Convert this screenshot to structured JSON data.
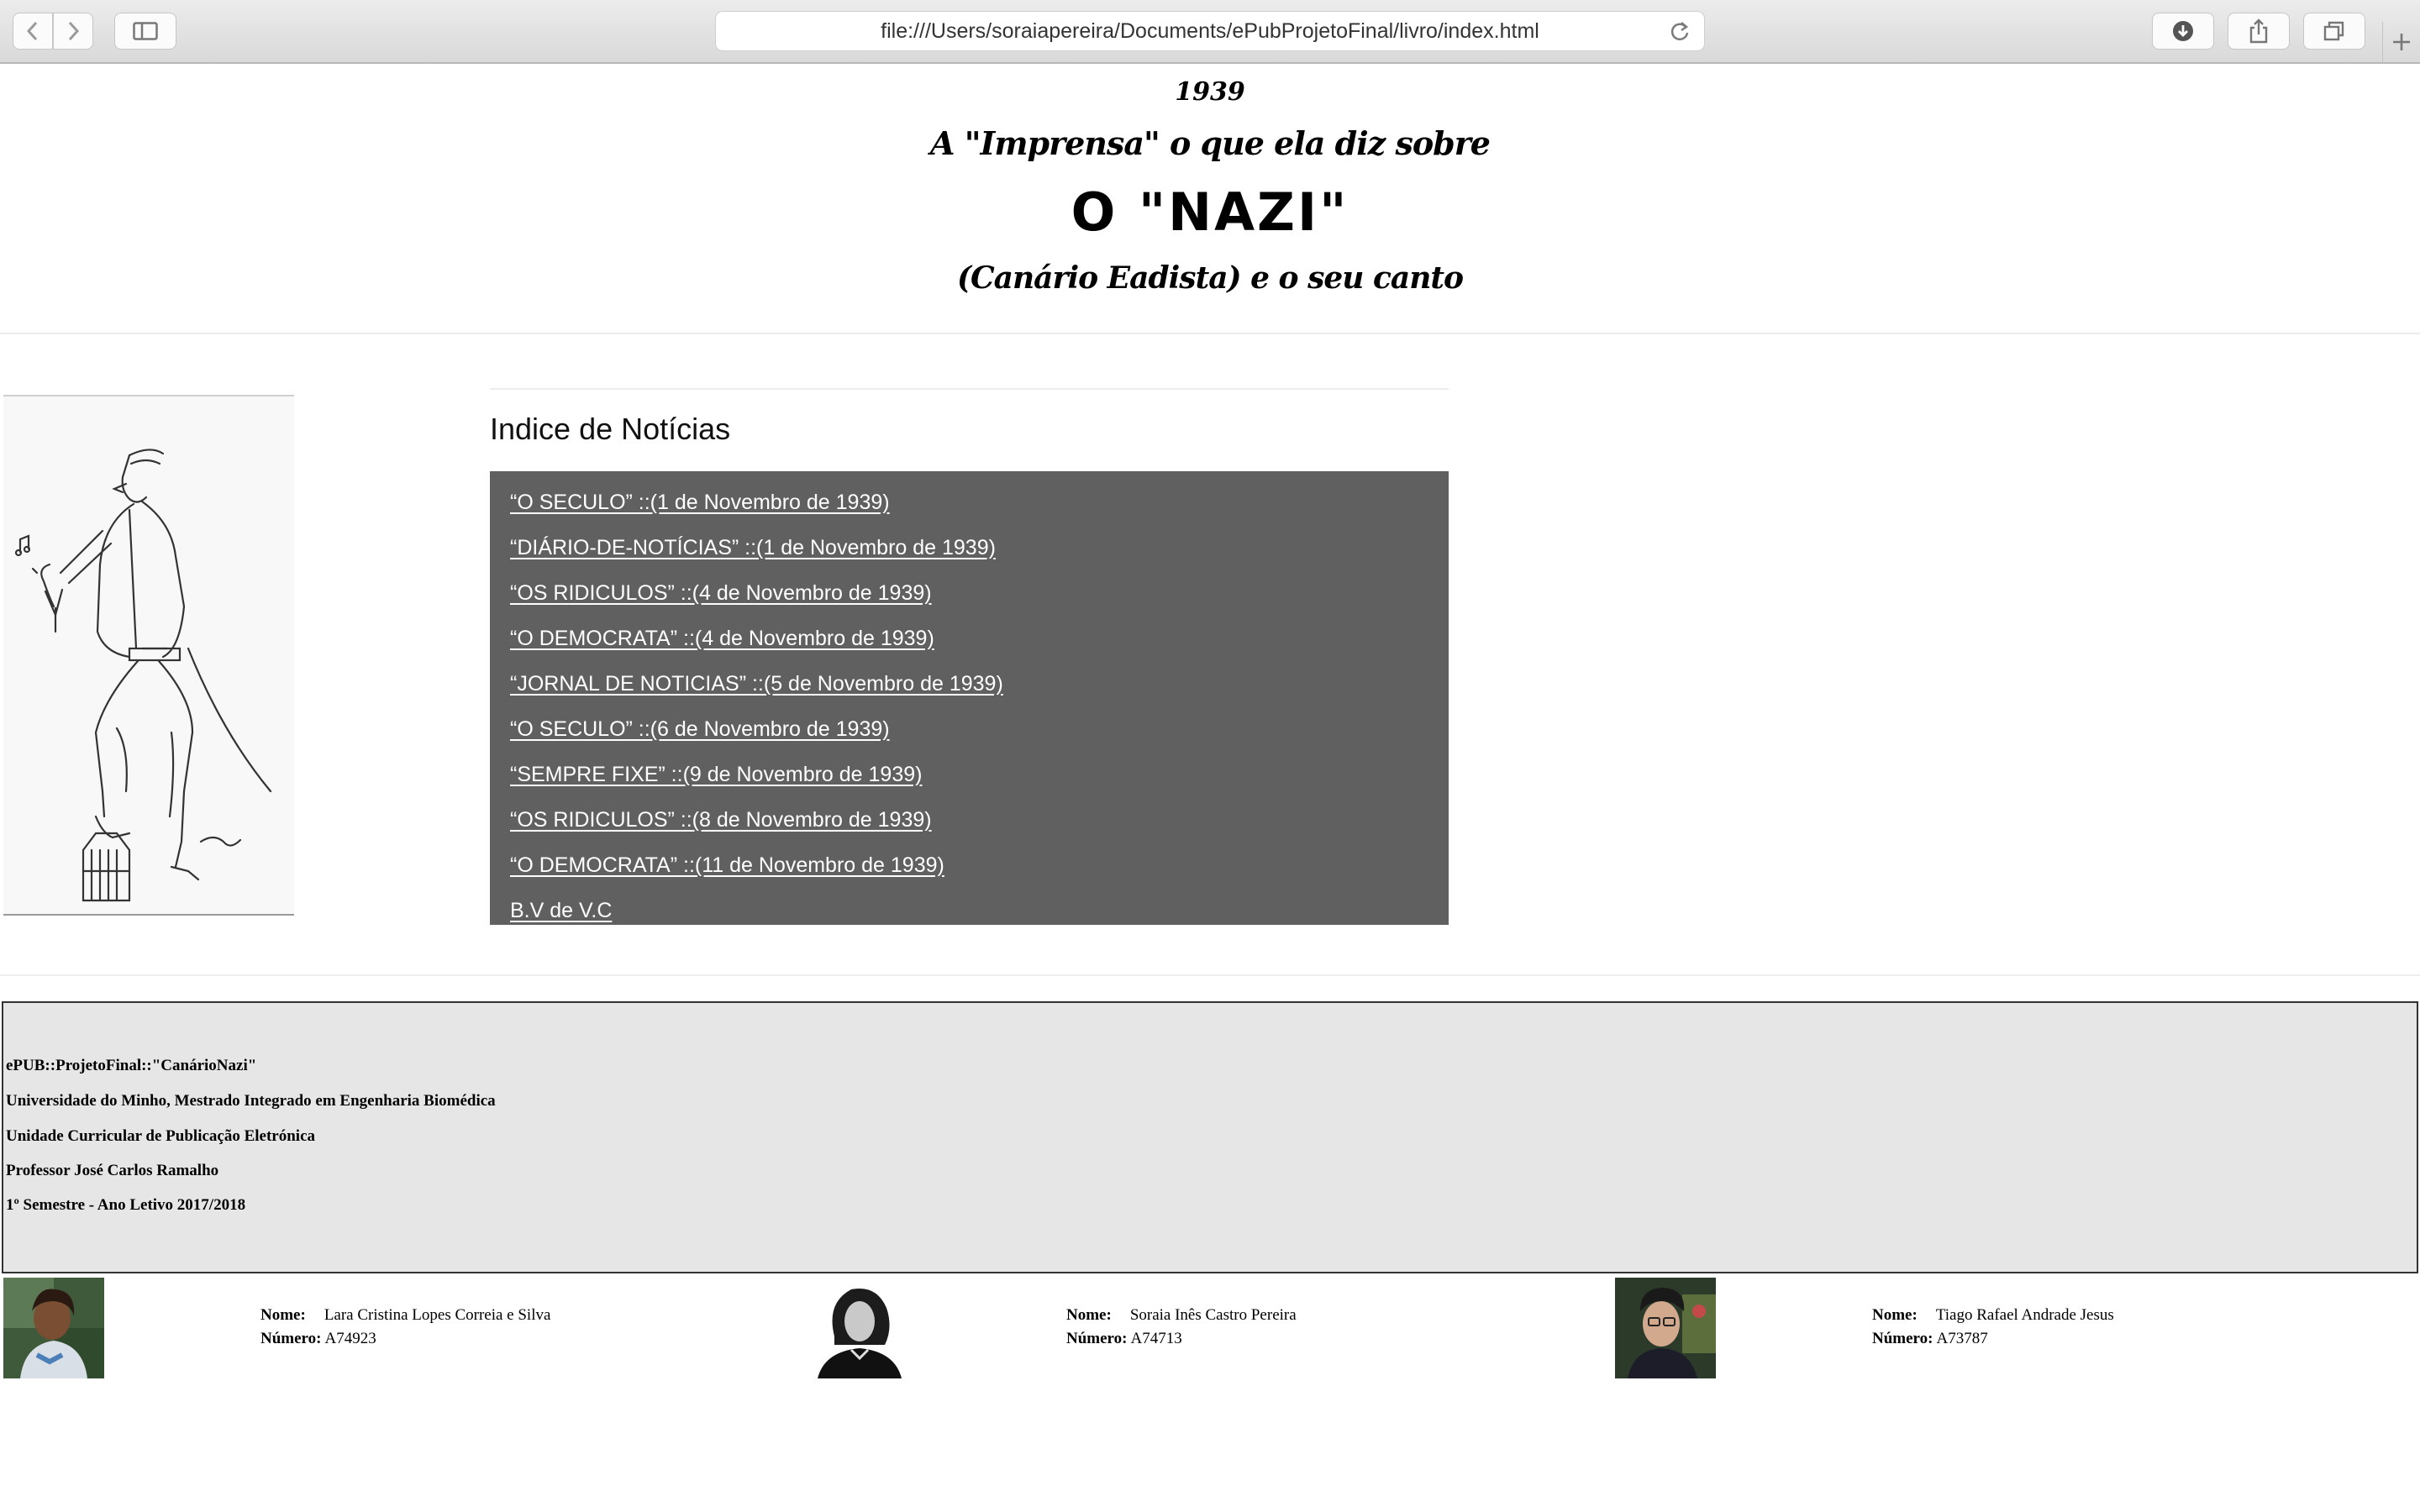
{
  "browser": {
    "url": "file:///Users/soraiapereira/Documents/ePubProjetoFinal/livro/index.html"
  },
  "header": {
    "year": "1939",
    "subtitle": "A \"Imprensa\" o que ela diz sobre",
    "title": "O \"NAZI\"",
    "subtitle2": "(Canário Eadista) e o seu canto"
  },
  "index": {
    "title": "Indice de Notícias",
    "items": [
      "“O SECULO” ::(1 de Novembro de 1939)",
      "“DIÁRIO-DE-NOTÍCIAS” ::(1 de Novembro de 1939)",
      "“OS RIDICULOS” ::(4 de Novembro de 1939)",
      "“O DEMOCRATA” ::(4 de Novembro de 1939)",
      "“JORNAL DE NOTICIAS” ::(5 de Novembro de 1939)",
      "“O SECULO” ::(6 de Novembro de 1939)",
      "“SEMPRE FIXE” ::(9 de Novembro de 1939)",
      "“OS RIDICULOS” ::(8 de Novembro de 1939)",
      "“O DEMOCRATA” ::(11 de Novembro de 1939)",
      "B.V de V.C"
    ]
  },
  "footer": {
    "lines": [
      "ePUB::ProjetoFinal::\"CanárioNazi\"",
      "Universidade do Minho, Mestrado Integrado em Engenharia Biomédica",
      "Unidade Curricular de Publicação Eletrónica",
      "Professor José Carlos Ramalho",
      "1º Semestre - Ano Letivo 2017/2018"
    ]
  },
  "members": {
    "name_label": "Nome:",
    "number_label": "Número:",
    "list": [
      {
        "name": "Lara Cristina Lopes Correia e Silva",
        "number": "A74923"
      },
      {
        "name": "Soraia Inês Castro Pereira",
        "number": "A74713"
      },
      {
        "name": "Tiago Rafael Andrade Jesus",
        "number": "A73787"
      }
    ]
  },
  "colors": {
    "index_bg": "#606060",
    "footer_bg": "#e6e6e6"
  }
}
